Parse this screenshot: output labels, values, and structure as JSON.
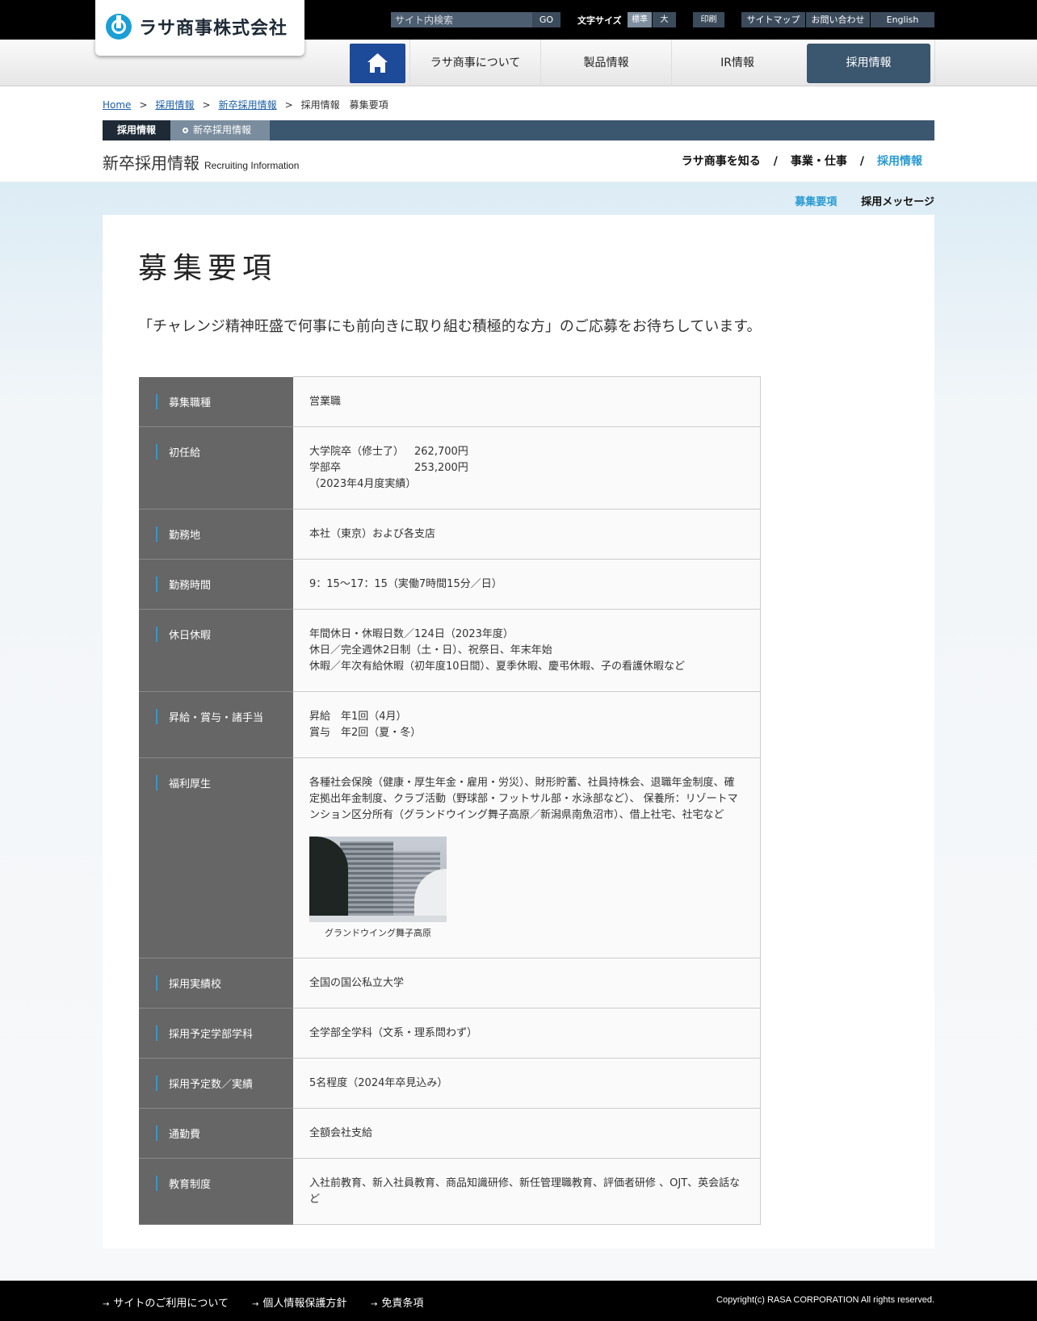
{
  "header": {
    "logo_text": "ラサ商事株式会社",
    "search_placeholder": "サイト内検索",
    "search_button": "GO",
    "font_size_label": "文字サイズ",
    "font_size_normal": "標準",
    "font_size_large": "大",
    "print": "印刷",
    "sitemap": "サイトマップ",
    "contact": "お問い合わせ",
    "english": "English"
  },
  "nav": {
    "home_icon": "home-icon",
    "about": "ラサ商事について",
    "products": "製品情報",
    "ir": "IR情報",
    "recruit": "採用情報"
  },
  "breadcrumb": {
    "home": "Home",
    "recruit": "採用情報",
    "newgrad": "新卒採用情報",
    "current": "採用情報　募集要項",
    "sep": ">"
  },
  "section_bar": {
    "active": "採用情報",
    "sub": "新卒採用情報"
  },
  "page_heading": {
    "jp": "新卒採用情報",
    "en": "Recruiting Information"
  },
  "right_nav": {
    "item1": "ラサ商事を知る",
    "item2": "事業・仕事",
    "item3": "採用情報",
    "sep": "/"
  },
  "sub_nav": {
    "active": "募集要項",
    "item": "採用メッセージ"
  },
  "main": {
    "title": "募集要項",
    "lead": "「チャレンジ精神旺盛で何事にも前向きに取り組む積極的な方」のご応募をお待ちしています。"
  },
  "table": {
    "job_label": "募集職種",
    "job_value": "営業職",
    "salary_label": "初任給",
    "salary_grad_label": "大学院卒（修士了）",
    "salary_grad_value": "262,700円",
    "salary_bach_label": "学部卒",
    "salary_bach_value": "253,200円",
    "salary_note": "（2023年4月度実績）",
    "location_label": "勤務地",
    "location_value": "本社（東京）および各支店",
    "hours_label": "勤務時間",
    "hours_value": "9：15～17：15（実働7時間15分／日）",
    "holiday_label": "休日休暇",
    "holiday_line1": "年間休日・休暇日数／124日（2023年度）",
    "holiday_line2": "休日／完全週休2日制（土・日）、祝祭日、年末年始",
    "holiday_line3": "休暇／年次有給休暇（初年度10日間）、夏季休暇、慶弔休暇、子の看護休暇など",
    "raise_label": "昇給・賞与・諸手当",
    "raise_line1": "昇給　年1回（4月）",
    "raise_line2": "賞与　年2回（夏・冬）",
    "welfare_label": "福利厚生",
    "welfare_value": "各種社会保険（健康・厚生年金・雇用・労災）、財形貯蓄、社員持株会、退職年金制度、確定拠出年金制度、クラブ活動（野球部・フットサル部・水泳部など）、 保養所：リゾートマンション区分所有（グランドウイング舞子高原／新潟県南魚沼市）、借上社宅、社宅など",
    "welfare_caption": "グランドウイング舞子高原",
    "schools_label": "採用実績校",
    "schools_value": "全国の国公私立大学",
    "faculty_label": "採用予定学部学科",
    "faculty_value": "全学部全学科（文系・理系問わず）",
    "count_label": "採用予定数／実績",
    "count_value": "5名程度（2024年卒見込み）",
    "commute_label": "通勤費",
    "commute_value": "全額会社支給",
    "education_label": "教育制度",
    "education_value": "入社前教育、新入社員教育、商品知識研修、新任管理職教育、評価者研修 、OJT、英会話など"
  },
  "footer": {
    "link1": "サイトのご利用について",
    "link2": "個人情報保護方針",
    "link3": "免責条項",
    "copyright": "Copyright(c) RASA CORPORATION All rights reserved."
  },
  "colors": {
    "nav_active": "#3b566f",
    "home_button": "#1e4a9a",
    "accent": "#2a9bd2",
    "table_header": "#666666"
  }
}
